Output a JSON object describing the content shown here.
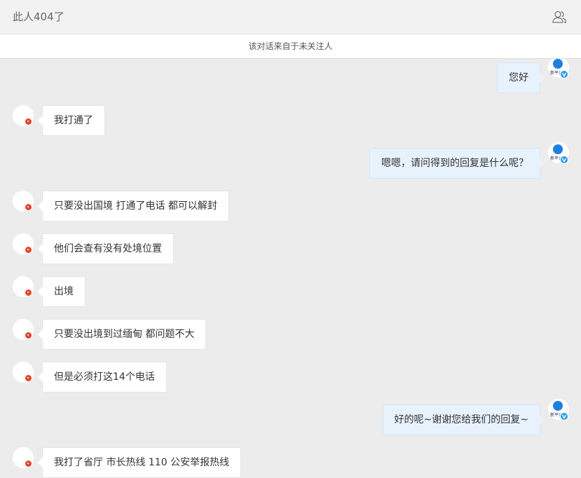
{
  "header": {
    "title": "此人404了",
    "contacts_icon": "contacts-icon"
  },
  "notice": "该对话来自于未关注人",
  "colors": {
    "background": "#ececec",
    "my_bubble": "#e7f2fd",
    "their_bubble": "#ffffff",
    "red_badge": "#e2462b",
    "blue_badge": "#2b9ce6"
  },
  "messages": [
    {
      "side": "right",
      "text": "您好"
    },
    {
      "side": "left",
      "text": "我打通了"
    },
    {
      "side": "right",
      "text": "嗯嗯，请问得到的回复是什么呢？"
    },
    {
      "side": "left",
      "text": "只要没出国境 打通了电话 都可以解封"
    },
    {
      "side": "left",
      "text": "他们会查有没有处境位置"
    },
    {
      "side": "left",
      "text": "出境"
    },
    {
      "side": "left",
      "text": "只要没出境到过缅甸 都问题不大"
    },
    {
      "side": "left",
      "text": "但是必须打这14个电话"
    },
    {
      "side": "right",
      "text": "好的呢~谢谢您给我们的回复~"
    },
    {
      "side": "left",
      "text": "我打了省厅 市长热线 110 公安举报热线"
    }
  ],
  "official_avatar_text": "新平公"
}
